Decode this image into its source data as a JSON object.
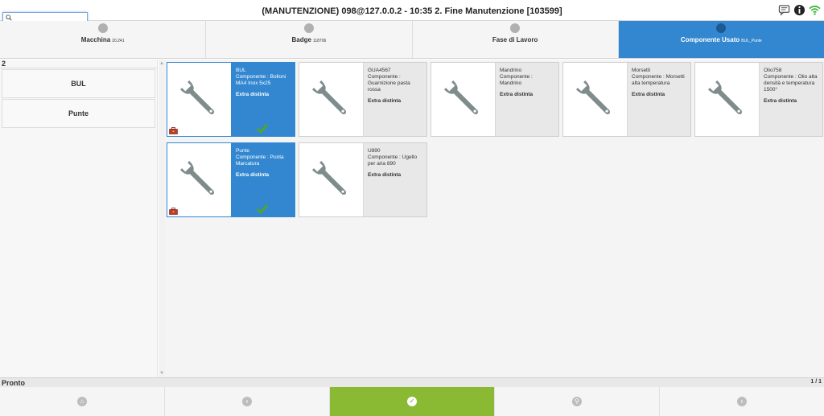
{
  "header": {
    "title": "(MANUTENZIONE) 098@127.0.0.2 - 10:35   2. Fine Manutenzione [103599]",
    "search_value": ""
  },
  "steps": [
    {
      "label": "Macchina",
      "sub": "20.241",
      "active": false
    },
    {
      "label": "Badge",
      "sub": "118706",
      "active": false
    },
    {
      "label": "Fase di Lavoro",
      "sub": "",
      "active": false
    },
    {
      "label": "Componente Usato",
      "sub": "BUL_Punte",
      "active": true
    }
  ],
  "left_panel": {
    "count": "2",
    "items": [
      "BUL",
      "Punte"
    ]
  },
  "cards": [
    {
      "name": "BUL",
      "component": "Componente : Bolloni MA4 Inox 5x25",
      "extra": "Extra distinta",
      "selected": true
    },
    {
      "name": "GUA4567",
      "component": "Componente : Guarnizione pasta rossa",
      "extra": "Extra distinta",
      "selected": false
    },
    {
      "name": "Mandrino",
      "component": "Componente : Mandrino",
      "extra": "Extra distinta",
      "selected": false
    },
    {
      "name": "Morsetti",
      "component": "Componente : Morsetti alta temperatura",
      "extra": "Extra distinta",
      "selected": false
    },
    {
      "name": "Olio758",
      "component": "Componente : Olio alta densità e temperatura 1500°",
      "extra": "Extra distinta",
      "selected": false
    },
    {
      "name": "Punte",
      "component": "Componente : Punta Marcatura",
      "extra": "Extra distinta",
      "selected": true
    },
    {
      "name": "U890",
      "component": "Componente : Ugello per aria 890",
      "extra": "Extra distinta",
      "selected": false
    }
  ],
  "status": {
    "text": "Pronto",
    "page": "1 / 1"
  },
  "colors": {
    "accent": "#3287d0",
    "ok": "#8ab934"
  },
  "nav_icons": [
    "home-icon",
    "back-icon",
    "confirm-icon",
    "search-icon",
    "forward-icon"
  ]
}
